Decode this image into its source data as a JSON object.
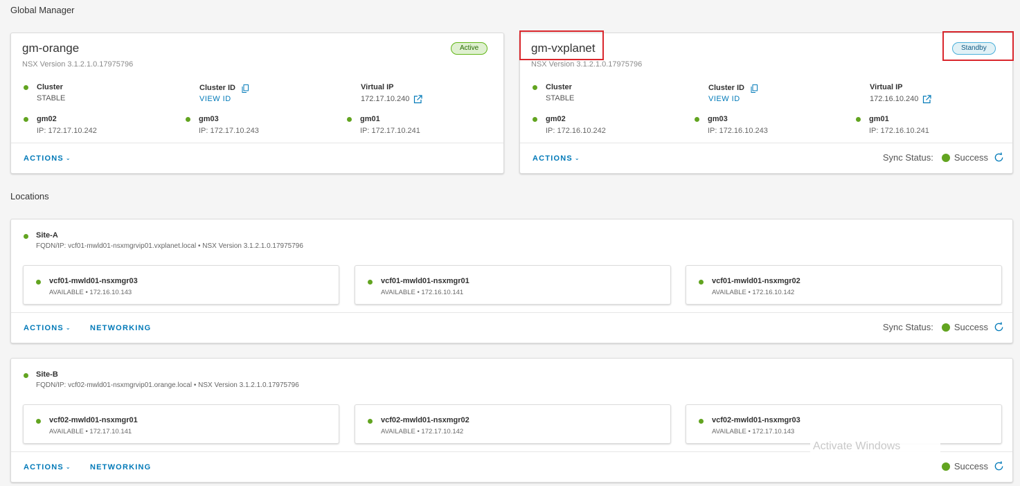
{
  "global_manager": {
    "section_title": "Global Manager",
    "cards": [
      {
        "name": "gm-orange",
        "status": "Active",
        "nsx_version": "NSX Version  3.1.2.1.0.17975796",
        "cluster_label": "Cluster",
        "cluster_status": "STABLE",
        "cluster_id_label": "Cluster ID",
        "view_id": "VIEW ID",
        "virtual_ip_label": "Virtual IP",
        "virtual_ip": "172.17.10.240",
        "nodes": [
          {
            "name": "gm02",
            "ip": "IP: 172.17.10.242"
          },
          {
            "name": "gm03",
            "ip": "IP: 172.17.10.243"
          },
          {
            "name": "gm01",
            "ip": "IP: 172.17.10.241"
          }
        ],
        "actions": "ACTIONS"
      },
      {
        "name": "gm-vxplanet",
        "status": "Standby",
        "nsx_version": "NSX Version  3.1.2.1.0.17975796",
        "cluster_label": "Cluster",
        "cluster_status": "STABLE",
        "cluster_id_label": "Cluster ID",
        "view_id": "VIEW ID",
        "virtual_ip_label": "Virtual IP",
        "virtual_ip": "172.16.10.240",
        "nodes": [
          {
            "name": "gm02",
            "ip": "IP: 172.16.10.242"
          },
          {
            "name": "gm03",
            "ip": "IP: 172.16.10.243"
          },
          {
            "name": "gm01",
            "ip": "IP: 172.16.10.241"
          }
        ],
        "actions": "ACTIONS",
        "sync_label": "Sync Status:",
        "sync_value": "Success"
      }
    ]
  },
  "locations": {
    "section_title": "Locations",
    "sites": [
      {
        "name": "Site-A",
        "fqdn": "FQDN/IP: vcf01-mwld01-nsxmgrvip01.vxplanet.local • NSX Version 3.1.2.1.0.17975796",
        "managers": [
          {
            "name": "vcf01-mwld01-nsxmgr03",
            "status": "AVAILABLE • 172.16.10.143"
          },
          {
            "name": "vcf01-mwld01-nsxmgr01",
            "status": "AVAILABLE • 172.16.10.141"
          },
          {
            "name": "vcf01-mwld01-nsxmgr02",
            "status": "AVAILABLE • 172.16.10.142"
          }
        ],
        "actions": "ACTIONS",
        "networking": "NETWORKING",
        "sync_label": "Sync Status:",
        "sync_value": "Success"
      },
      {
        "name": "Site-B",
        "fqdn": "FQDN/IP: vcf02-mwld01-nsxmgrvip01.orange.local • NSX Version 3.1.2.1.0.17975796",
        "managers": [
          {
            "name": "vcf02-mwld01-nsxmgr01",
            "status": "AVAILABLE • 172.17.10.141"
          },
          {
            "name": "vcf02-mwld01-nsxmgr02",
            "status": "AVAILABLE • 172.17.10.142"
          },
          {
            "name": "vcf02-mwld01-nsxmgr03",
            "status": "AVAILABLE • 172.17.10.143"
          }
        ],
        "actions": "ACTIONS",
        "networking": "NETWORKING",
        "sync_value": "Success"
      }
    ]
  },
  "watermark": "Activate Windows",
  "colors": {
    "status_green": "#62a420",
    "link_blue": "#0079b8",
    "highlight_red": "#d9262c"
  }
}
